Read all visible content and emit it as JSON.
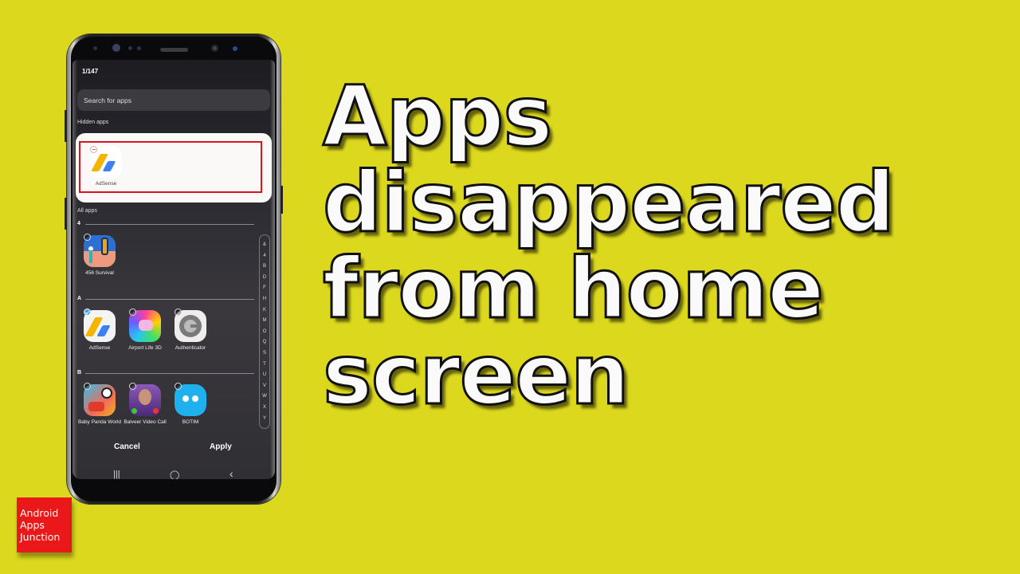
{
  "phone": {
    "app_count": "1/147",
    "search": {
      "placeholder": "Search for apps"
    },
    "hidden_section": {
      "label": "Hidden apps",
      "apps": [
        {
          "name": "AdSense",
          "icon": "adsense-icon"
        }
      ]
    },
    "all_section": {
      "label": "All apps",
      "groups": [
        {
          "letter": "4",
          "apps": [
            {
              "name": "456 Survival",
              "icon": "456-survival-icon",
              "checked": false
            }
          ]
        },
        {
          "letter": "A",
          "apps": [
            {
              "name": "AdSense",
              "icon": "adsense-icon",
              "checked": true
            },
            {
              "name": "Airport Life 3D",
              "icon": "airport-life-icon",
              "checked": false
            },
            {
              "name": "Authenticator",
              "icon": "authenticator-icon",
              "checked": false
            }
          ]
        },
        {
          "letter": "B",
          "apps": [
            {
              "name": "Baby Panda World",
              "icon": "baby-panda-icon",
              "checked": false
            },
            {
              "name": "Balveer Video Call",
              "icon": "balveer-icon",
              "checked": false
            },
            {
              "name": "BOTIM",
              "icon": "botim-icon",
              "checked": false
            }
          ]
        }
      ]
    },
    "index_letters": [
      "&",
      "4",
      "B",
      "D",
      "F",
      "H",
      "K",
      "M",
      "O",
      "Q",
      "S",
      "T",
      "U",
      "V",
      "W",
      "X",
      "Y"
    ],
    "buttons": {
      "cancel": "Cancel",
      "apply": "Apply"
    },
    "nav": {
      "recents": "|||",
      "home": "◯",
      "back": "‹"
    }
  },
  "title": {
    "lines": [
      "Apps",
      "disappeared",
      "from home",
      "screen"
    ]
  },
  "logo": {
    "lines": [
      "Android",
      "Apps",
      "Junction"
    ]
  },
  "colors": {
    "background": "#dcd81e",
    "highlight": "#d8141c",
    "logo": "#ea1818",
    "check": "#3ea6e8"
  }
}
